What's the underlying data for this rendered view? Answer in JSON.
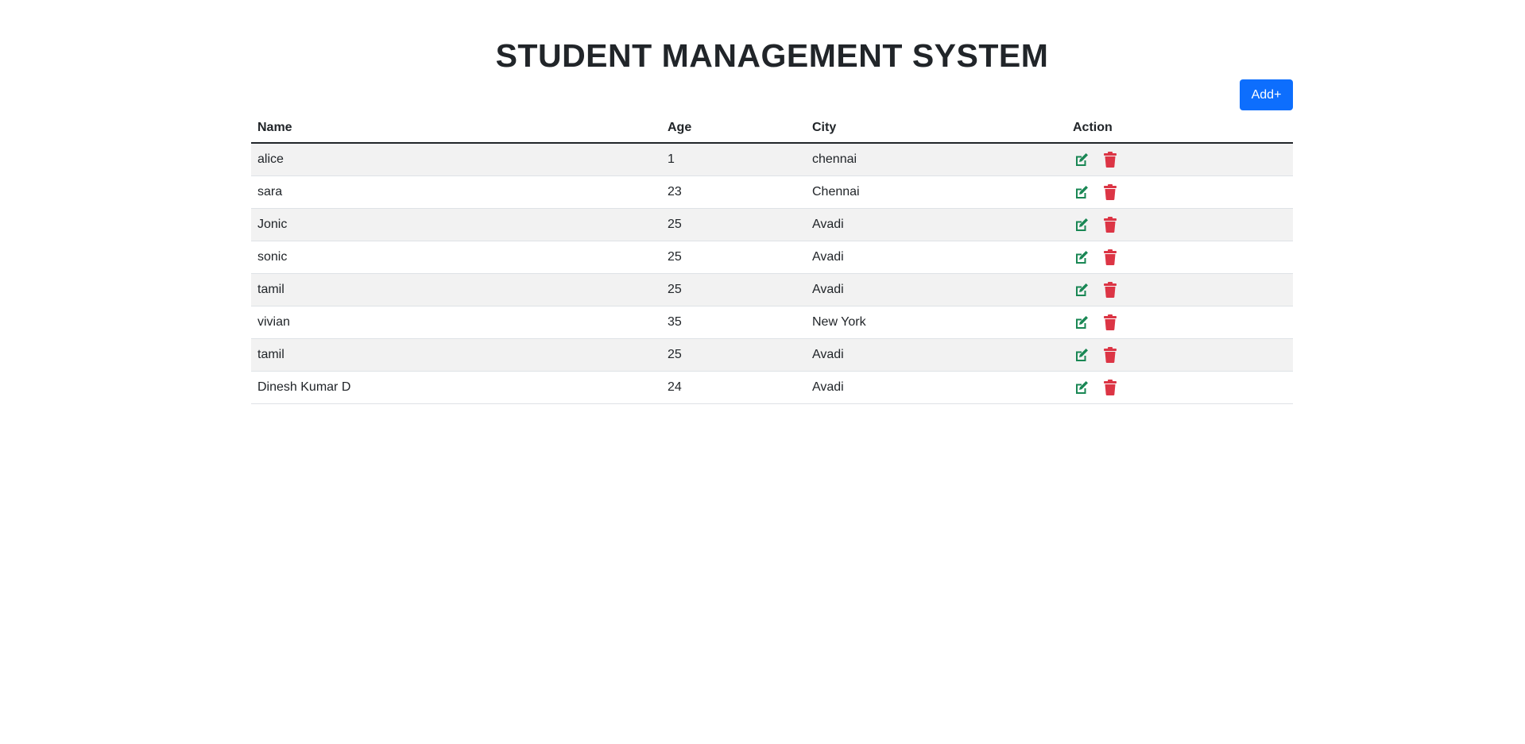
{
  "page": {
    "title": "STUDENT MANAGEMENT SYSTEM",
    "add_button_label": "Add+"
  },
  "table": {
    "headers": {
      "name": "Name",
      "age": "Age",
      "city": "City",
      "action": "Action"
    },
    "rows": [
      {
        "name": "alice",
        "age": "1",
        "city": "chennai"
      },
      {
        "name": "sara",
        "age": "23",
        "city": "Chennai"
      },
      {
        "name": "Jonic",
        "age": "25",
        "city": "Avadi"
      },
      {
        "name": "sonic",
        "age": "25",
        "city": "Avadi"
      },
      {
        "name": "tamil",
        "age": "25",
        "city": "Avadi"
      },
      {
        "name": "vivian",
        "age": "35",
        "city": "New York"
      },
      {
        "name": "tamil",
        "age": "25",
        "city": "Avadi"
      },
      {
        "name": "Dinesh Kumar D",
        "age": "24",
        "city": "Avadi"
      }
    ],
    "row_actions": [
      {
        "icon": "edit-icon",
        "color": "#198754"
      },
      {
        "icon": "trash-icon",
        "color": "#dc3545"
      }
    ]
  },
  "colors": {
    "primary": "#0d6efd",
    "edit": "#198754",
    "delete": "#dc3545",
    "stripe": "#f2f2f2"
  }
}
